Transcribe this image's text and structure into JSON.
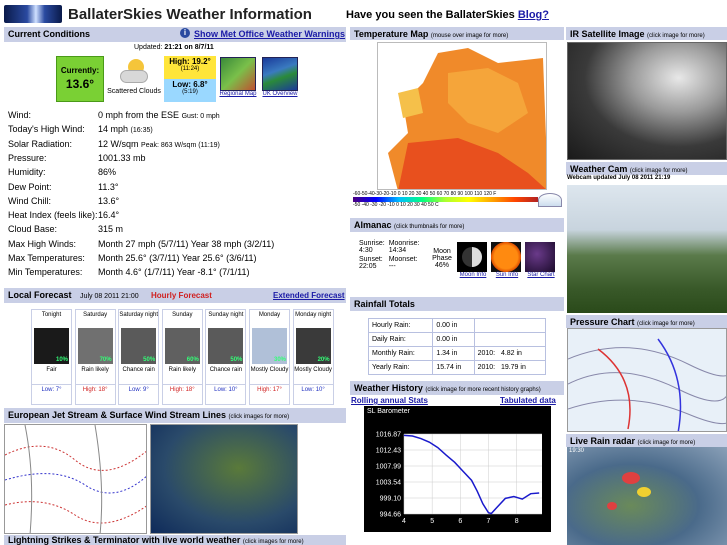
{
  "header": {
    "title": "BallaterSkies Weather Information",
    "promo_text": "Have you seen the BallaterSkies",
    "promo_link": "Blog?"
  },
  "current": {
    "title": "Current Conditions",
    "warning_link": "Show Met Office Weather Warnings",
    "updated_label": "Updated:",
    "updated_value": "21:21 on 8/7/11",
    "currently_label": "Currently:",
    "currently_value": "13.6°",
    "condition": "Scattered Clouds",
    "high_label": "High: 19.2°",
    "high_time": "(11:24)",
    "low_label": "Low: 6.8°",
    "low_time": "(5:19)",
    "regional_map": "Regional Map",
    "uk_overview": "UK Overview"
  },
  "stats": [
    {
      "k": "Wind:",
      "v": "0 mph from the ESE",
      "x": "Gust: 0 mph"
    },
    {
      "k": "Today's High Wind:",
      "v": "14 mph",
      "x": "(16:35)"
    },
    {
      "k": "Solar Radiation:",
      "v": "12 W/sqm",
      "x": "Peak: 863 W/sqm (11:19)"
    },
    {
      "k": "Pressure:",
      "v": "1001.33 mb",
      "x": ""
    },
    {
      "k": "Humidity:",
      "v": "86%",
      "x": ""
    },
    {
      "k": "Dew Point:",
      "v": "11.3°",
      "x": ""
    },
    {
      "k": "Wind Chill:",
      "v": "13.6°",
      "x": ""
    },
    {
      "k": "Heat Index (feels like):",
      "v": "16.4°",
      "x": ""
    },
    {
      "k": "Cloud Base:",
      "v": "315 m",
      "x": ""
    },
    {
      "k": "Max High Winds:",
      "v": "Month 27 mph (5/7/11) Year 38 mph (3/2/11)",
      "x": ""
    },
    {
      "k": "Max Temperatures:",
      "v": "Month 25.6° (3/7/11) Year 25.6° (3/6/11)",
      "x": ""
    },
    {
      "k": "Min Temperatures:",
      "v": "Month 4.6° (1/7/11) Year -8.1° (7/1/11)",
      "x": ""
    }
  ],
  "forecast": {
    "title": "Local Forecast",
    "date": "July 08 2011 21:00",
    "hourly": "Hourly Forecast",
    "extended": "Extended Forecast",
    "days": [
      {
        "day": "Tonight",
        "pct": "10%",
        "desc": "Fair",
        "temp": "Low: 7°",
        "hi": false
      },
      {
        "day": "Saturday",
        "pct": "70%",
        "desc": "Rain likely",
        "temp": "High: 18°",
        "hi": true
      },
      {
        "day": "Saturday night",
        "pct": "50%",
        "desc": "Chance rain",
        "temp": "Low: 9°",
        "hi": false
      },
      {
        "day": "Sunday",
        "pct": "60%",
        "desc": "Rain likely",
        "temp": "High: 18°",
        "hi": true
      },
      {
        "day": "Sunday night",
        "pct": "50%",
        "desc": "Chance rain",
        "temp": "Low: 10°",
        "hi": false
      },
      {
        "day": "Monday",
        "pct": "30%",
        "desc": "Mostly Cloudy",
        "temp": "High: 17°",
        "hi": true
      },
      {
        "day": "Monday night",
        "pct": "20%",
        "desc": "Mostly Cloudy",
        "temp": "Low: 10°",
        "hi": false
      }
    ]
  },
  "jetstream": {
    "title": "European Jet Stream & Surface Wind Stream Lines",
    "note": "(click images for more)"
  },
  "lightning": {
    "title": "Lightning Strikes & Terminator with live world weather",
    "note": "(click images for more)"
  },
  "tempmap": {
    "title": "Temperature Map",
    "note": "(mouse over image for more)",
    "scale_top": "-60-50-40-30-20-10  0  10  20  30  40  50  60  70  80  90 100 110 120  F",
    "scale_bot": "-50  -40  -30  -20  -10   0   10   20   30   40   50  C"
  },
  "almanac": {
    "title": "Almanac",
    "note": "(click thumbnails for more)",
    "sunrise_label": "Sunrise:",
    "sunrise": "4:30",
    "moonrise_label": "Moonrise:",
    "moonrise": "14:34",
    "sunset_label": "Sunset:",
    "sunset": "22:05",
    "moonset_label": "Moonset:",
    "moonset": "---",
    "phase_label": "Moon Phase",
    "phase": "46%",
    "moon_info": "Moon Info",
    "sun_info": "Sun Info",
    "star_chart": "Star Chart"
  },
  "rainfall": {
    "title": "Rainfall Totals",
    "rows": [
      {
        "k": "Hourly Rain:",
        "v": "0.00 in",
        "y": "",
        "yv": ""
      },
      {
        "k": "Daily Rain:",
        "v": "0.00 in",
        "y": "",
        "yv": ""
      },
      {
        "k": "Monthly Rain:",
        "v": "1.34 in",
        "y": "2010:",
        "yv": "4.82 in"
      },
      {
        "k": "Yearly Rain:",
        "v": "15.74 in",
        "y": "2010:",
        "yv": "19.79 in"
      }
    ]
  },
  "history": {
    "title": "Weather History",
    "note": "(click image for more recent history graphs)",
    "rolling": "Rolling annual Stats",
    "tabulated": "Tabulated data"
  },
  "chart_data": {
    "type": "line",
    "title": "SL Barometer",
    "x_ticks": [
      "4",
      "5",
      "6",
      "7",
      "8"
    ],
    "y_ticks": [
      "1016.87",
      "1012.43",
      "1007.99",
      "1003.54",
      "999.10",
      "994.66"
    ],
    "ylim": [
      994.66,
      1016.87
    ],
    "xlim": [
      4,
      8.9
    ],
    "x": [
      4,
      4.3,
      4.6,
      4.9,
      5.2,
      5.5,
      5.8,
      6.1,
      6.4,
      6.6,
      6.8,
      7.0,
      7.1,
      7.3,
      7.6,
      7.9,
      8.2,
      8.5,
      8.8
    ],
    "values": [
      1016.5,
      1016.3,
      1015.6,
      1014.6,
      1013.1,
      1011.0,
      1009.0,
      1006.5,
      1004.0,
      1001.0,
      997.5,
      995.0,
      994.8,
      996.5,
      999.0,
      999.5,
      998.8,
      1000.3,
      1000.5
    ]
  },
  "satellite": {
    "title": "IR Satellite Image",
    "note": "(click image for more)"
  },
  "webcam": {
    "title": "Weather Cam",
    "note": "(click image for more)",
    "updated": "Webcam updated July 08 2011 21:19"
  },
  "pressure_chart": {
    "title": "Pressure Chart",
    "note": "(click image for more)"
  },
  "radar": {
    "title": "Live Rain radar",
    "note": "(click image for more)",
    "time": "19:30"
  }
}
